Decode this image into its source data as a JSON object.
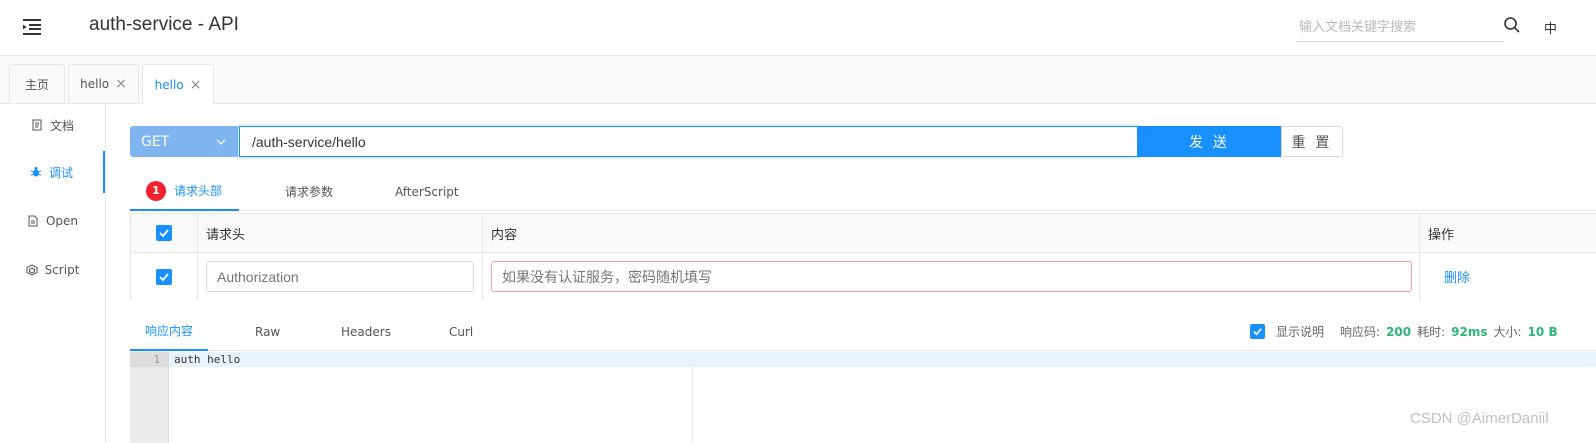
{
  "header": {
    "title": "auth-service - API",
    "search_placeholder": "输入文档关键字搜索",
    "lang": "中"
  },
  "tabs": [
    {
      "label": "主页",
      "closable": false,
      "active": false
    },
    {
      "label": "hello",
      "closable": true,
      "active": false
    },
    {
      "label": "hello",
      "closable": true,
      "active": true
    }
  ],
  "close_glyph": "×",
  "sidebar": {
    "items": [
      {
        "label": "文档",
        "icon": "document-icon",
        "active": false
      },
      {
        "label": "调试",
        "icon": "bug-icon",
        "active": true
      },
      {
        "label": "Open",
        "icon": "file-icon",
        "active": false
      },
      {
        "label": "Script",
        "icon": "code-icon",
        "active": false
      }
    ]
  },
  "request": {
    "method": "GET",
    "url": "/auth-service/hello",
    "send_label": "发 送",
    "reset_label": "重 置"
  },
  "request_tabs": {
    "badge_count": "1",
    "items": [
      "请求头部",
      "请求参数",
      "AfterScript"
    ]
  },
  "headers_table": {
    "columns": [
      "请求头",
      "内容",
      "操作"
    ],
    "rows": [
      {
        "checked": true,
        "name_placeholder": "Authorization",
        "value_placeholder": "如果没有认证服务，密码随机填写",
        "action": "删除"
      }
    ]
  },
  "response": {
    "tabs": [
      "响应内容",
      "Raw",
      "Headers",
      "Curl"
    ],
    "show_desc_label": "显示说明",
    "status_label": "响应码:",
    "status_value": "200",
    "time_label": "耗时:",
    "time_value": "92ms",
    "size_label": "大小:",
    "size_value": "10 B",
    "line_number": "1",
    "body": "auth hello"
  },
  "watermark": "CSDN @AimerDaniil",
  "colors": {
    "accent": "#1890ff",
    "method_bg": "#7fb4ef",
    "success": "#2db67c",
    "badge": "#f5222d"
  }
}
